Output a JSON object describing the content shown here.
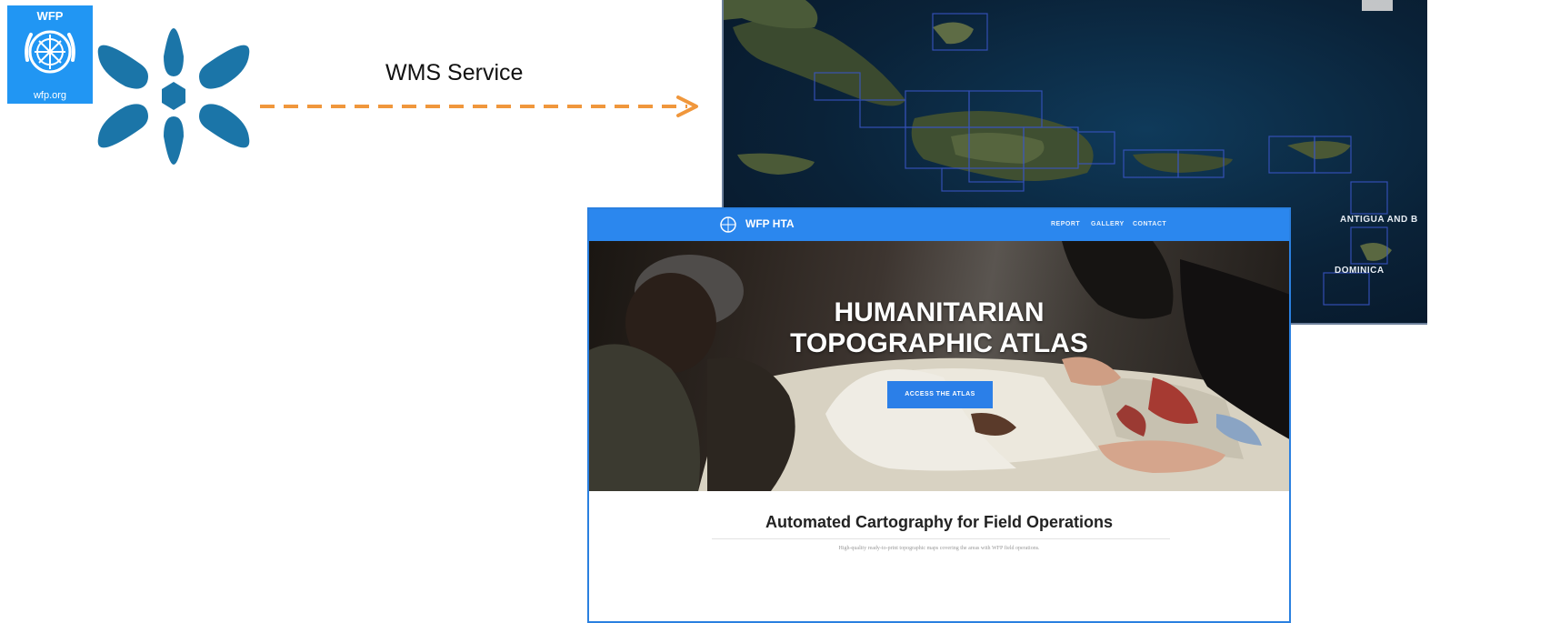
{
  "wfp_logo": {
    "top_text": "WFP",
    "bottom_text": "wfp.org",
    "color": "#2196f3"
  },
  "flower_logo": {
    "icon": "geonode-flower-icon",
    "color": "#1b75a8"
  },
  "arrow": {
    "label": "WMS Service",
    "color": "#f0973c"
  },
  "satellite_map": {
    "labels": {
      "antigua": "ANTIGUA AND B",
      "dominica": "DOMINICA"
    }
  },
  "website": {
    "brand": "WFP HTA",
    "nav": [
      "REPORT",
      "GALLERY",
      "CONTACT"
    ],
    "hero_title_line1": "HUMANITARIAN",
    "hero_title_line2": "TOPOGRAPHIC ATLAS",
    "hero_button": "ACCESS THE ATLAS",
    "subtitle": "Automated Cartography for Field Operations",
    "tagline": "High-quality ready-to-print topographic maps covering the areas with WFP field operations.",
    "nav_color": "#2b87ee"
  }
}
